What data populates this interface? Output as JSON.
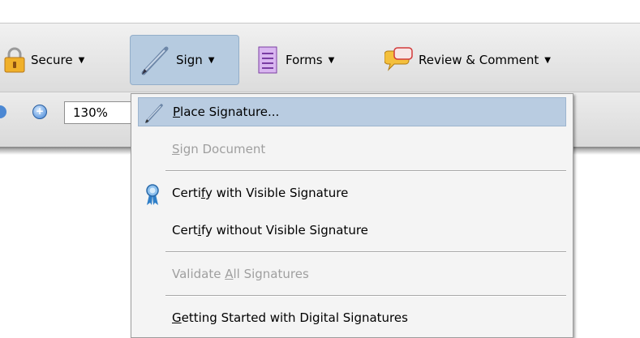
{
  "toolbar": {
    "secure": {
      "label": "Secure",
      "icon": "lock-icon"
    },
    "sign": {
      "label": "Sign",
      "icon": "pen-icon"
    },
    "forms": {
      "label": "Forms",
      "icon": "form-icon"
    },
    "review": {
      "label": "Review & Comment",
      "icon": "speech-bubble-icon"
    },
    "caret": "▼"
  },
  "zoom": {
    "value": "130%",
    "icon": "zoom-in-icon"
  },
  "menu": {
    "items": [
      {
        "label": "Place Signature...",
        "accel": "P",
        "state": "highlighted",
        "icon": "pen-icon"
      },
      {
        "label": "Sign Document",
        "accel": "S",
        "state": "disabled"
      },
      {
        "label": "Certify with Visible Signature",
        "accel": "f",
        "state": "enabled",
        "icon": "ribbon-icon"
      },
      {
        "label": "Certify without Visible Signature",
        "accel": "i",
        "state": "enabled"
      },
      {
        "label": "Validate All Signatures",
        "accel": "A",
        "state": "disabled"
      },
      {
        "label": "Getting Started with Digital Signatures",
        "accel": "G",
        "state": "enabled"
      }
    ]
  },
  "colors": {
    "highlight": "#b9cce1",
    "disabled_text": "#9f9f9f",
    "toolbar_active": "#b6cbe0"
  }
}
